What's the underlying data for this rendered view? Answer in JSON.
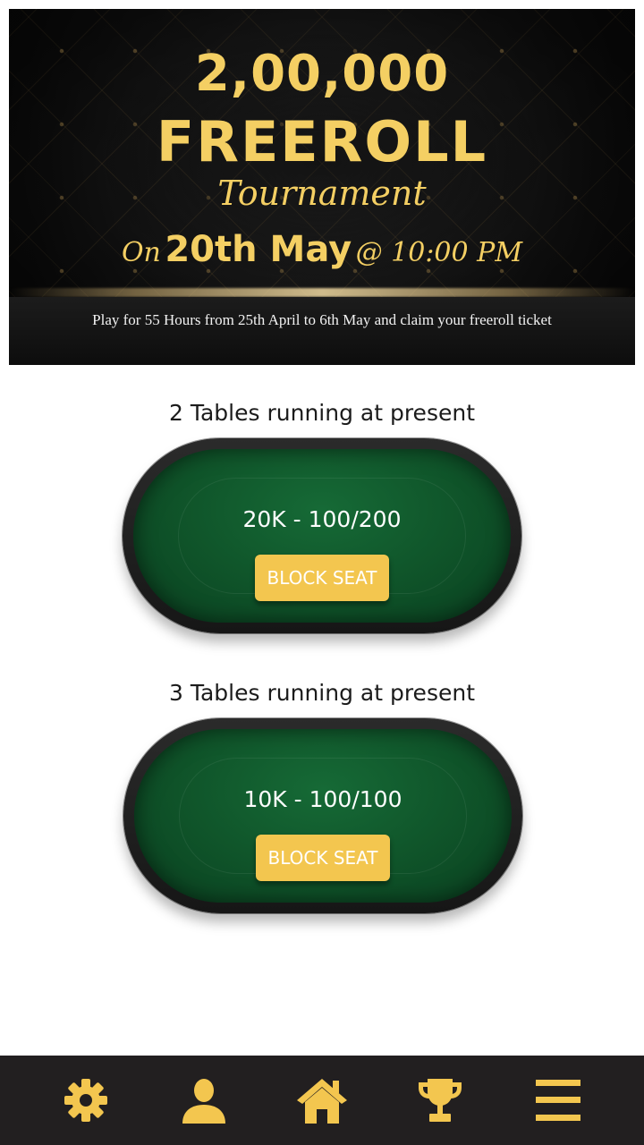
{
  "banner": {
    "amount": "2,00,000",
    "title": "FREEROLL",
    "subtitle": "Tournament",
    "date_prefix": "On",
    "date": "20th May",
    "time": "@ 10:00 PM",
    "note": "Play for 55 Hours from 25th April to 6th May and claim your freeroll ticket"
  },
  "tables": [
    {
      "label": "2 Tables running at present",
      "stakes": "20K - 100/200",
      "button": "BLOCK SEAT"
    },
    {
      "label": "3 Tables running at present",
      "stakes": "10K - 100/100",
      "button": "BLOCK SEAT"
    }
  ],
  "nav": {
    "items": [
      {
        "icon": "gear-icon"
      },
      {
        "icon": "user-icon"
      },
      {
        "icon": "home-icon"
      },
      {
        "icon": "trophy-icon"
      },
      {
        "icon": "menu-icon"
      }
    ]
  },
  "colors": {
    "accent": "#f3c64f",
    "banner_gold": "#f4cf63",
    "felt_green": "#0f5329",
    "nav_bg": "#221f20"
  }
}
